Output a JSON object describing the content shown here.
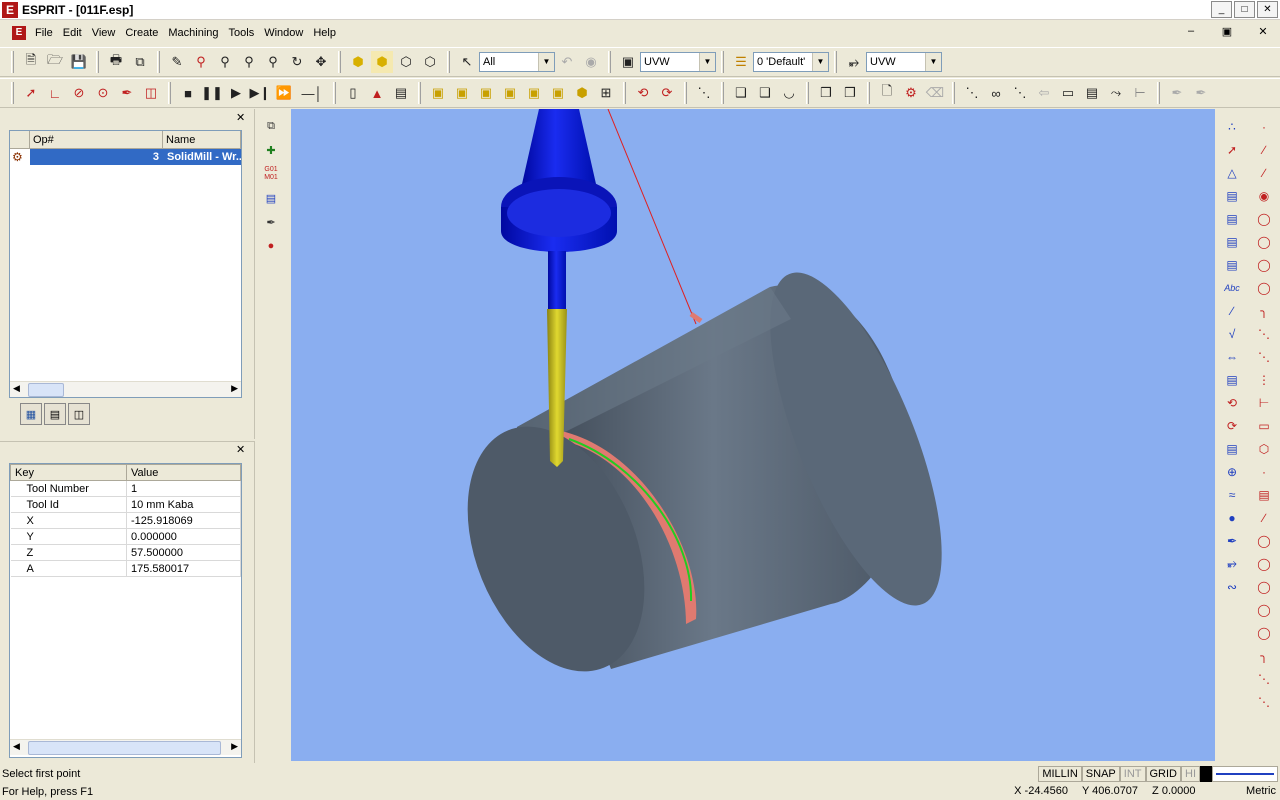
{
  "window": {
    "title": "ESPRIT - [011F.esp]",
    "app_letter": "E"
  },
  "window_buttons": [
    "_",
    "□",
    "✕"
  ],
  "menu": {
    "items": [
      "File",
      "Edit",
      "View",
      "Create",
      "Machining",
      "Tools",
      "Window",
      "Help"
    ]
  },
  "mdi_buttons": [
    "–",
    "▣",
    "✕"
  ],
  "toolbar1": {
    "select_filter": "All",
    "workplane": "UVW",
    "layer": "0 'Default'",
    "view_plane": "UVW"
  },
  "operations": {
    "columns": [
      "Op#",
      "Name"
    ],
    "rows": [
      {
        "op": "3",
        "name": "SolidMill - Wr..."
      }
    ]
  },
  "properties": {
    "columns": [
      "Key",
      "Value"
    ],
    "rows": [
      {
        "key": "Tool Number",
        "value": "1"
      },
      {
        "key": "Tool Id",
        "value": "10 mm Kaba"
      },
      {
        "key": "X",
        "value": "-125.918069"
      },
      {
        "key": "Y",
        "value": "0.000000"
      },
      {
        "key": "Z",
        "value": "57.500000"
      },
      {
        "key": "A",
        "value": "175.580017"
      }
    ]
  },
  "status": {
    "prompt": "Select first point",
    "help": "For Help, press F1",
    "mode_tags": [
      "MILLIN",
      "SNAP",
      "INT",
      "GRID",
      "HI"
    ],
    "x": "X -24.4560",
    "y": "Y 406.0707",
    "z": "Z 0.0000",
    "units": "Metric"
  },
  "colors": {
    "viewport_bg": "#8aaef0",
    "cylinder": "#5a6878",
    "toolholder": "#0a18c8",
    "tool_shank": "#c8c020",
    "cut_region": "#e07a70",
    "toolpath": "#22cc22",
    "selection": "#316ac5"
  }
}
